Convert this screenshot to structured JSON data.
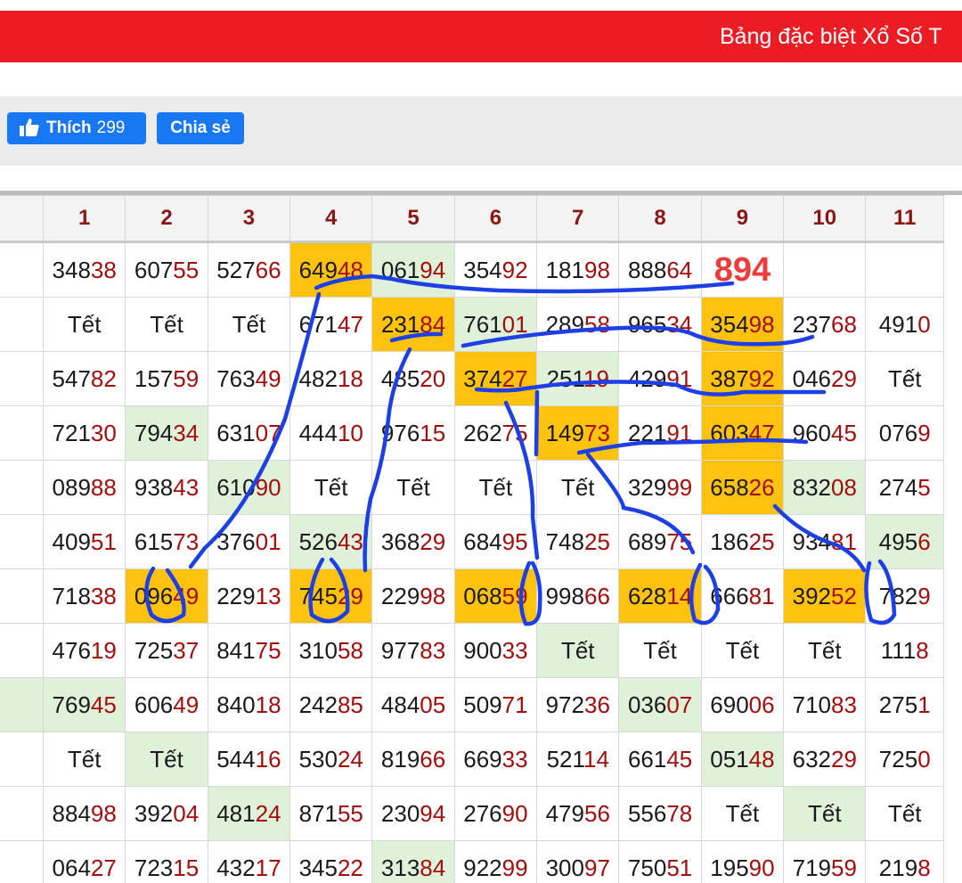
{
  "header": {
    "title": "Bảng đặc biệt Xổ Số T"
  },
  "social": {
    "like_label": "Thích",
    "like_count": "299",
    "share_label": "Chia sẻ"
  },
  "columns": [
    "",
    "1",
    "2",
    "3",
    "4",
    "5",
    "6",
    "7",
    "8",
    "9",
    "10",
    "11"
  ],
  "rows": [
    [
      {
        "a": "",
        "b": ""
      },
      {
        "a": "348",
        "b": "38"
      },
      {
        "a": "607",
        "b": "55"
      },
      {
        "a": "527",
        "b": "66"
      },
      {
        "a": "649",
        "b": "48",
        "bg": "o"
      },
      {
        "a": "061",
        "b": "94",
        "bg": "g"
      },
      {
        "a": "354",
        "b": "92"
      },
      {
        "a": "181",
        "b": "98"
      },
      {
        "a": "888",
        "b": "64"
      },
      {
        "a": "894",
        "b": "",
        "special": true
      },
      {
        "a": "",
        "b": ""
      },
      {
        "a": "",
        "b": ""
      }
    ],
    [
      {
        "a": "",
        "b": ""
      },
      {
        "a": "Tết",
        "b": ""
      },
      {
        "a": "Tết",
        "b": ""
      },
      {
        "a": "Tết",
        "b": ""
      },
      {
        "a": "671",
        "b": "47"
      },
      {
        "a": "231",
        "b": "84",
        "bg": "o"
      },
      {
        "a": "761",
        "b": "01",
        "bg": "g"
      },
      {
        "a": "289",
        "b": "58"
      },
      {
        "a": "965",
        "b": "34"
      },
      {
        "a": "354",
        "b": "98",
        "bg": "o"
      },
      {
        "a": "237",
        "b": "68"
      },
      {
        "a": "491",
        "b": "0"
      }
    ],
    [
      {
        "a": "",
        "b": ""
      },
      {
        "a": "547",
        "b": "82"
      },
      {
        "a": "157",
        "b": "59"
      },
      {
        "a": "763",
        "b": "49"
      },
      {
        "a": "482",
        "b": "18"
      },
      {
        "a": "485",
        "b": "20"
      },
      {
        "a": "374",
        "b": "27",
        "bg": "o"
      },
      {
        "a": "251",
        "b": "19",
        "bg": "g"
      },
      {
        "a": "429",
        "b": "91"
      },
      {
        "a": "387",
        "b": "92",
        "bg": "o"
      },
      {
        "a": "046",
        "b": "29"
      },
      {
        "a": "Tết",
        "b": ""
      }
    ],
    [
      {
        "a": "",
        "b": ""
      },
      {
        "a": "721",
        "b": "30"
      },
      {
        "a": "794",
        "b": "34",
        "bg": "g"
      },
      {
        "a": "631",
        "b": "07"
      },
      {
        "a": "444",
        "b": "10"
      },
      {
        "a": "976",
        "b": "15"
      },
      {
        "a": "262",
        "b": "75"
      },
      {
        "a": "149",
        "b": "73",
        "bg": "o"
      },
      {
        "a": "221",
        "b": "91"
      },
      {
        "a": "603",
        "b": "47",
        "bg": "o"
      },
      {
        "a": "960",
        "b": "45"
      },
      {
        "a": "076",
        "b": "9"
      }
    ],
    [
      {
        "a": "",
        "b": ""
      },
      {
        "a": "089",
        "b": "88"
      },
      {
        "a": "938",
        "b": "43"
      },
      {
        "a": "610",
        "b": "90",
        "bg": "g"
      },
      {
        "a": "Tết",
        "b": ""
      },
      {
        "a": "Tết",
        "b": ""
      },
      {
        "a": "Tết",
        "b": ""
      },
      {
        "a": "Tết",
        "b": ""
      },
      {
        "a": "329",
        "b": "99"
      },
      {
        "a": "658",
        "b": "26",
        "bg": "o"
      },
      {
        "a": "832",
        "b": "08",
        "bg": "g"
      },
      {
        "a": "274",
        "b": "5"
      }
    ],
    [
      {
        "a": "",
        "b": ""
      },
      {
        "a": "409",
        "b": "51"
      },
      {
        "a": "615",
        "b": "73"
      },
      {
        "a": "376",
        "b": "01"
      },
      {
        "a": "526",
        "b": "43",
        "bg": "g"
      },
      {
        "a": "368",
        "b": "29"
      },
      {
        "a": "684",
        "b": "95"
      },
      {
        "a": "748",
        "b": "25"
      },
      {
        "a": "689",
        "b": "75"
      },
      {
        "a": "186",
        "b": "25"
      },
      {
        "a": "934",
        "b": "81"
      },
      {
        "a": "495",
        "b": "6",
        "bg": "g"
      }
    ],
    [
      {
        "a": "",
        "b": ""
      },
      {
        "a": "718",
        "b": "38"
      },
      {
        "a": "096",
        "b": "49",
        "bg": "o"
      },
      {
        "a": "229",
        "b": "13"
      },
      {
        "a": "745",
        "b": "29",
        "bg": "o"
      },
      {
        "a": "229",
        "b": "98"
      },
      {
        "a": "068",
        "b": "59",
        "bg": "o"
      },
      {
        "a": "998",
        "b": "66"
      },
      {
        "a": "628",
        "b": "14",
        "bg": "o"
      },
      {
        "a": "666",
        "b": "81"
      },
      {
        "a": "392",
        "b": "52",
        "bg": "o"
      },
      {
        "a": "782",
        "b": "9"
      }
    ],
    [
      {
        "a": "",
        "b": ""
      },
      {
        "a": "476",
        "b": "19"
      },
      {
        "a": "725",
        "b": "37"
      },
      {
        "a": "841",
        "b": "75"
      },
      {
        "a": "310",
        "b": "58"
      },
      {
        "a": "977",
        "b": "83"
      },
      {
        "a": "900",
        "b": "33"
      },
      {
        "a": "Tết",
        "b": "",
        "bg": "g"
      },
      {
        "a": "Tết",
        "b": ""
      },
      {
        "a": "Tết",
        "b": ""
      },
      {
        "a": "Tết",
        "b": ""
      },
      {
        "a": "111",
        "b": "8"
      }
    ],
    [
      {
        "a": "",
        "b": "",
        "bg": "g"
      },
      {
        "a": "769",
        "b": "45",
        "bg": "g"
      },
      {
        "a": "606",
        "b": "49"
      },
      {
        "a": "840",
        "b": "18"
      },
      {
        "a": "242",
        "b": "85"
      },
      {
        "a": "484",
        "b": "05"
      },
      {
        "a": "509",
        "b": "71"
      },
      {
        "a": "972",
        "b": "36"
      },
      {
        "a": "036",
        "b": "07",
        "bg": "g"
      },
      {
        "a": "690",
        "b": "06"
      },
      {
        "a": "710",
        "b": "83"
      },
      {
        "a": "275",
        "b": "1"
      }
    ],
    [
      {
        "a": "",
        "b": ""
      },
      {
        "a": "Tết",
        "b": ""
      },
      {
        "a": "Tết",
        "b": "",
        "bg": "g"
      },
      {
        "a": "544",
        "b": "16"
      },
      {
        "a": "530",
        "b": "24"
      },
      {
        "a": "819",
        "b": "66"
      },
      {
        "a": "669",
        "b": "33"
      },
      {
        "a": "521",
        "b": "14"
      },
      {
        "a": "661",
        "b": "45"
      },
      {
        "a": "051",
        "b": "48",
        "bg": "g"
      },
      {
        "a": "632",
        "b": "29"
      },
      {
        "a": "725",
        "b": "0"
      }
    ],
    [
      {
        "a": "",
        "b": ""
      },
      {
        "a": "884",
        "b": "98"
      },
      {
        "a": "392",
        "b": "04"
      },
      {
        "a": "481",
        "b": "24",
        "bg": "g"
      },
      {
        "a": "871",
        "b": "55"
      },
      {
        "a": "230",
        "b": "94"
      },
      {
        "a": "276",
        "b": "90"
      },
      {
        "a": "479",
        "b": "56"
      },
      {
        "a": "556",
        "b": "78"
      },
      {
        "a": "Tết",
        "b": ""
      },
      {
        "a": "Tết",
        "b": "",
        "bg": "g"
      },
      {
        "a": "Tết",
        "b": ""
      }
    ],
    [
      {
        "a": "",
        "b": ""
      },
      {
        "a": "064",
        "b": "27"
      },
      {
        "a": "723",
        "b": "15"
      },
      {
        "a": "432",
        "b": "17"
      },
      {
        "a": "345",
        "b": "22"
      },
      {
        "a": "313",
        "b": "84",
        "bg": "g"
      },
      {
        "a": "922",
        "b": "99"
      },
      {
        "a": "300",
        "b": "97"
      },
      {
        "a": "750",
        "b": "51"
      },
      {
        "a": "195",
        "b": "90"
      },
      {
        "a": "719",
        "b": "59"
      },
      {
        "a": "219",
        "b": "8"
      }
    ]
  ],
  "colors": {
    "accent_red": "#ec1c24",
    "highlight_orange": "#ffc20e",
    "highlight_green": "#dff1d9",
    "pen_blue": "#1d3fe6"
  }
}
